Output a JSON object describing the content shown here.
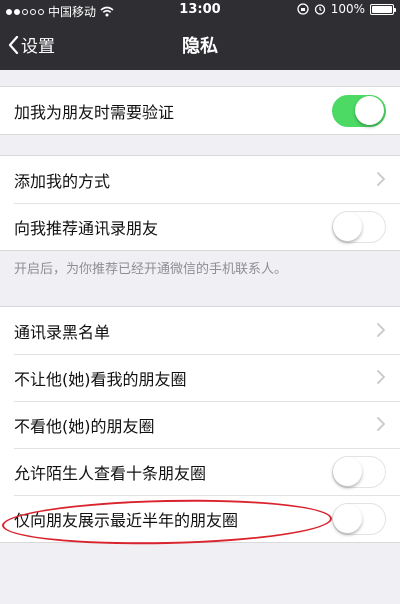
{
  "status_bar": {
    "carrier": "中国移动",
    "time": "13:00",
    "battery": "100%",
    "signal_bars": 2,
    "icons": [
      "wifi-icon",
      "rotation-lock-icon",
      "alarm-icon",
      "battery-icon"
    ]
  },
  "nav": {
    "back_label": "设置",
    "title": "隐私"
  },
  "section1": {
    "items": [
      {
        "label": "加我为朋友时需要验证",
        "toggle_on": true
      }
    ]
  },
  "section2": {
    "items": [
      {
        "label": "添加我的方式",
        "kind": "chevron"
      },
      {
        "label": "向我推荐通讯录朋友",
        "kind": "toggle",
        "toggle_on": false
      }
    ],
    "footer": "开启后，为你推荐已经开通微信的手机联系人。"
  },
  "section3": {
    "items": [
      {
        "label": "通讯录黑名单",
        "kind": "chevron"
      },
      {
        "label": "不让他(她)看我的朋友圈",
        "kind": "chevron"
      },
      {
        "label": "不看他(她)的朋友圈",
        "kind": "chevron"
      },
      {
        "label": "允许陌生人查看十条朋友圈",
        "kind": "toggle",
        "toggle_on": false
      },
      {
        "label": "仅向朋友展示最近半年的朋友圈",
        "kind": "toggle",
        "toggle_on": false
      }
    ]
  },
  "colors": {
    "nav_bg": "#2e2e33",
    "page_bg": "#efeff4",
    "toggle_on": "#4cd964",
    "annotation": "#d9232d",
    "hint_text": "#8e8e93"
  }
}
